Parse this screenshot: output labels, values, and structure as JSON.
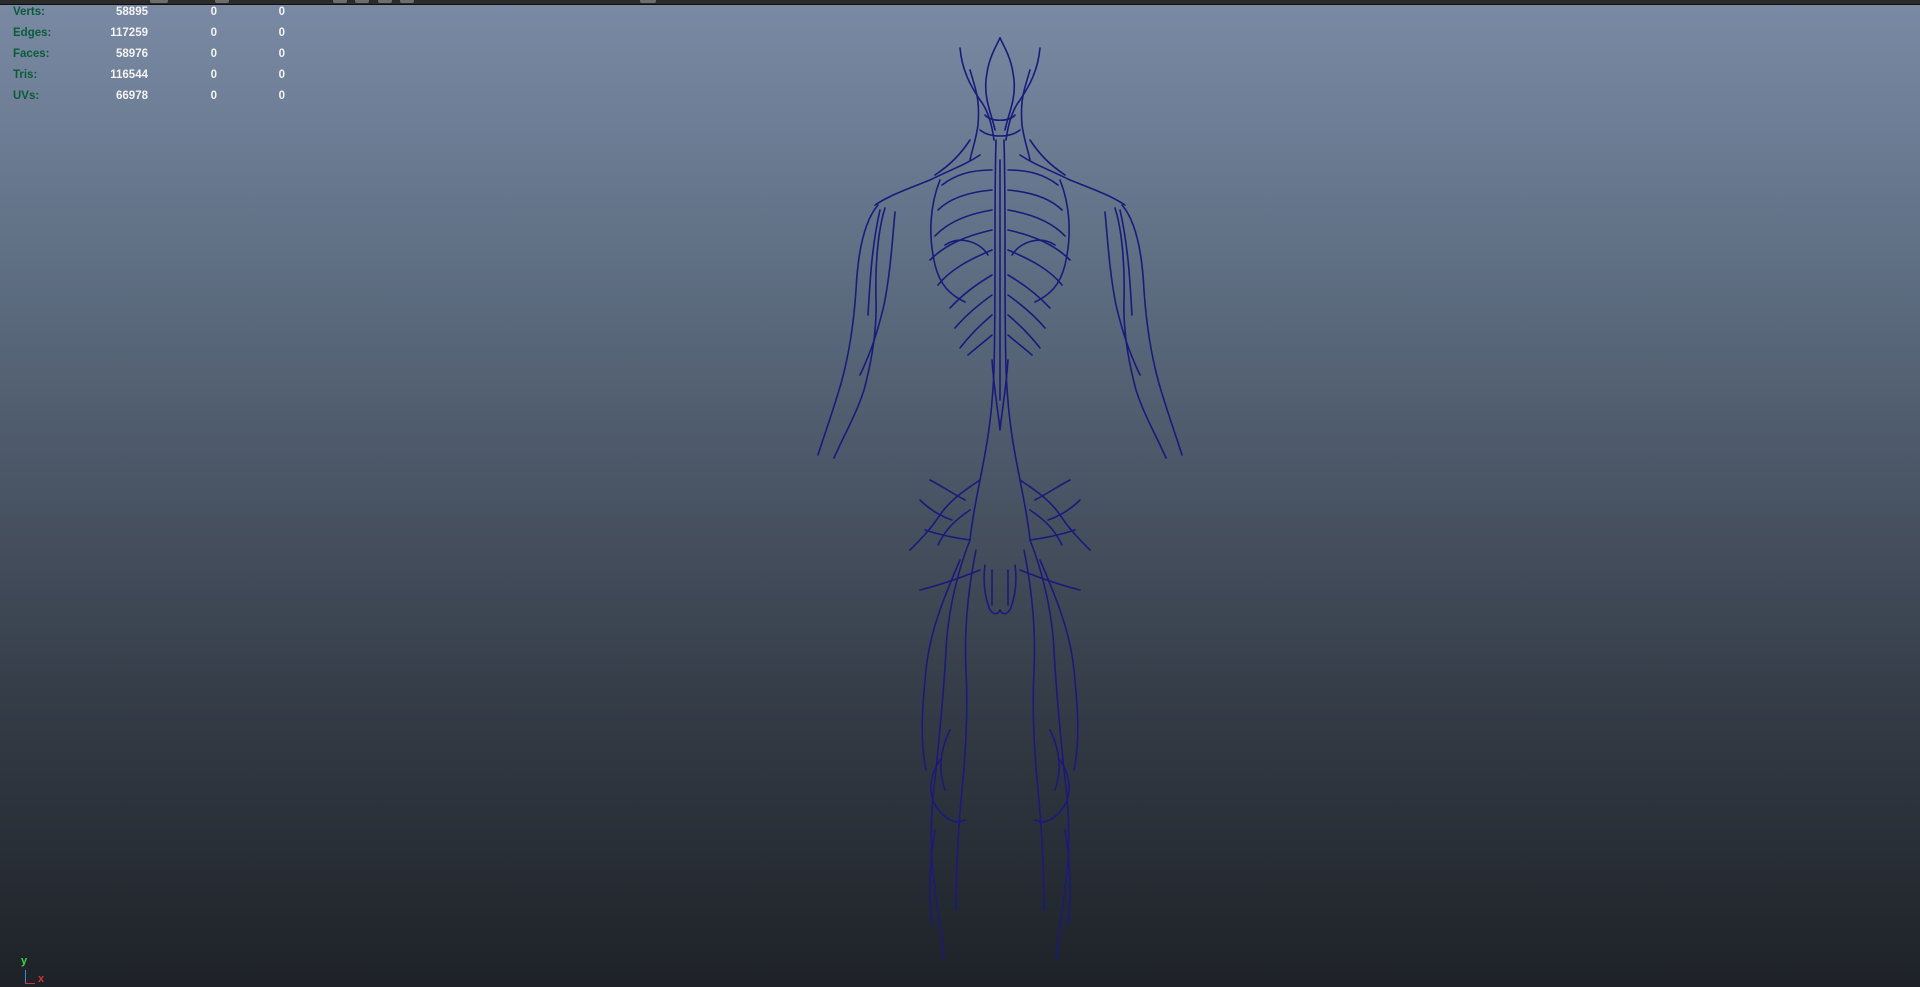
{
  "hud": {
    "rows": [
      {
        "label": "Verts:",
        "v1": "58895",
        "v2": "0",
        "v3": "0"
      },
      {
        "label": "Edges:",
        "v1": "117259",
        "v2": "0",
        "v3": "0"
      },
      {
        "label": "Faces:",
        "v1": "58976",
        "v2": "0",
        "v3": "0"
      },
      {
        "label": "Tris:",
        "v1": "116544",
        "v2": "0",
        "v3": "0"
      },
      {
        "label": "UVs:",
        "v1": "66978",
        "v2": "0",
        "v3": "0"
      }
    ]
  },
  "axis": {
    "y_label": "y",
    "x_label": "x"
  },
  "colors": {
    "wire": "#1a1a7a",
    "hud_label": "#0b5b39",
    "hud_value": "#f3f3f3"
  },
  "model": {
    "icon": "nervous-system-wireframe"
  }
}
